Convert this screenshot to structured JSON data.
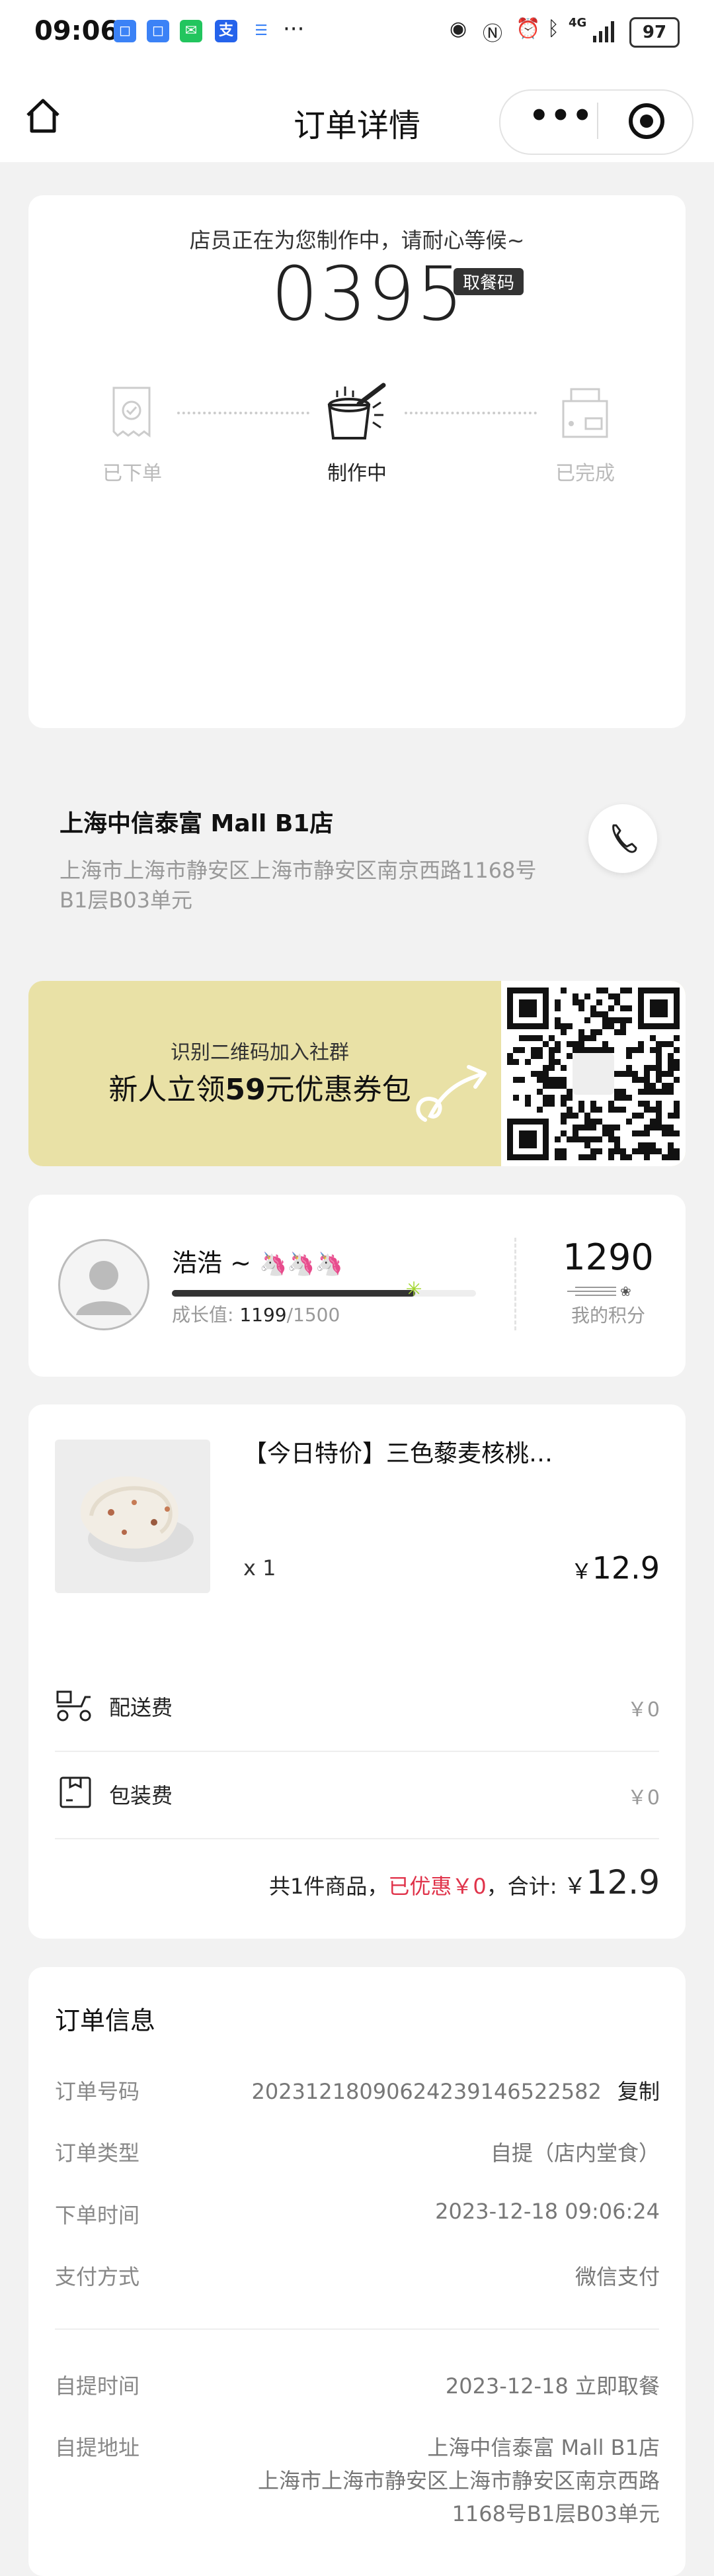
{
  "status_bar": {
    "time": "09:06",
    "dots": "···",
    "net": "4G",
    "battery": "97"
  },
  "nav": {
    "title": "订单详情",
    "more": "•••"
  },
  "order_status": {
    "message": "店员正在为您制作中，请耐心等候~",
    "pickup_code": "0395",
    "pickup_badge": "取餐码",
    "steps": [
      "已下单",
      "制作中",
      "已完成"
    ]
  },
  "store": {
    "name": "上海中信泰富 Mall B1店",
    "address_line1": "上海市上海市静安区上海市静安区南京西路1168号",
    "address_line2": "B1层B03单元"
  },
  "banner": {
    "line1": "识别二维码加入社群",
    "line2_a": "新人立领",
    "line2_num": "59",
    "line2_b": "元优惠券包"
  },
  "member": {
    "name": "浩浩 ~",
    "emoji": "🦄🦄🦄",
    "growth_label": "成长值:",
    "growth_current": "1199",
    "growth_total": "/1500",
    "growth_fraction": 0.799,
    "points": "1290",
    "points_label": "我的积分"
  },
  "product": {
    "name": "【今日特价】三色藜麦核桃…",
    "qty": "x 1",
    "currency": "￥",
    "price": "12.9"
  },
  "fees": [
    {
      "label": "配送费",
      "value": "￥0",
      "icon": "scooter-icon"
    },
    {
      "label": "包装费",
      "value": "￥0",
      "icon": "package-icon"
    }
  ],
  "summary": {
    "count": "共1件商品，",
    "discount": "已优惠￥0",
    "total_label": "，合计:",
    "currency": "￥",
    "total": "12.9"
  },
  "order_info": {
    "title": "订单信息",
    "order_no_label": "订单号码",
    "order_no": "20231218090624239146522582",
    "copy": "复制",
    "type_label": "订单类型",
    "type": "自提（店内堂食）",
    "time_label": "下单时间",
    "time": "2023-12-18 09:06:24",
    "pay_label": "支付方式",
    "pay": "微信支付",
    "pickup_time_label": "自提时间",
    "pickup_time": "2023-12-18 立即取餐",
    "pickup_addr_label": "自提地址",
    "pickup_addr_1": "上海中信泰富 Mall B1店",
    "pickup_addr_2": "上海市上海市静安区上海市静安区南京西路",
    "pickup_addr_3": "1168号B1层B03单元"
  },
  "colors": {
    "accent_red": "#e0334a",
    "banner_yellow": "#e9e1a6",
    "progress_dark": "#333333"
  }
}
